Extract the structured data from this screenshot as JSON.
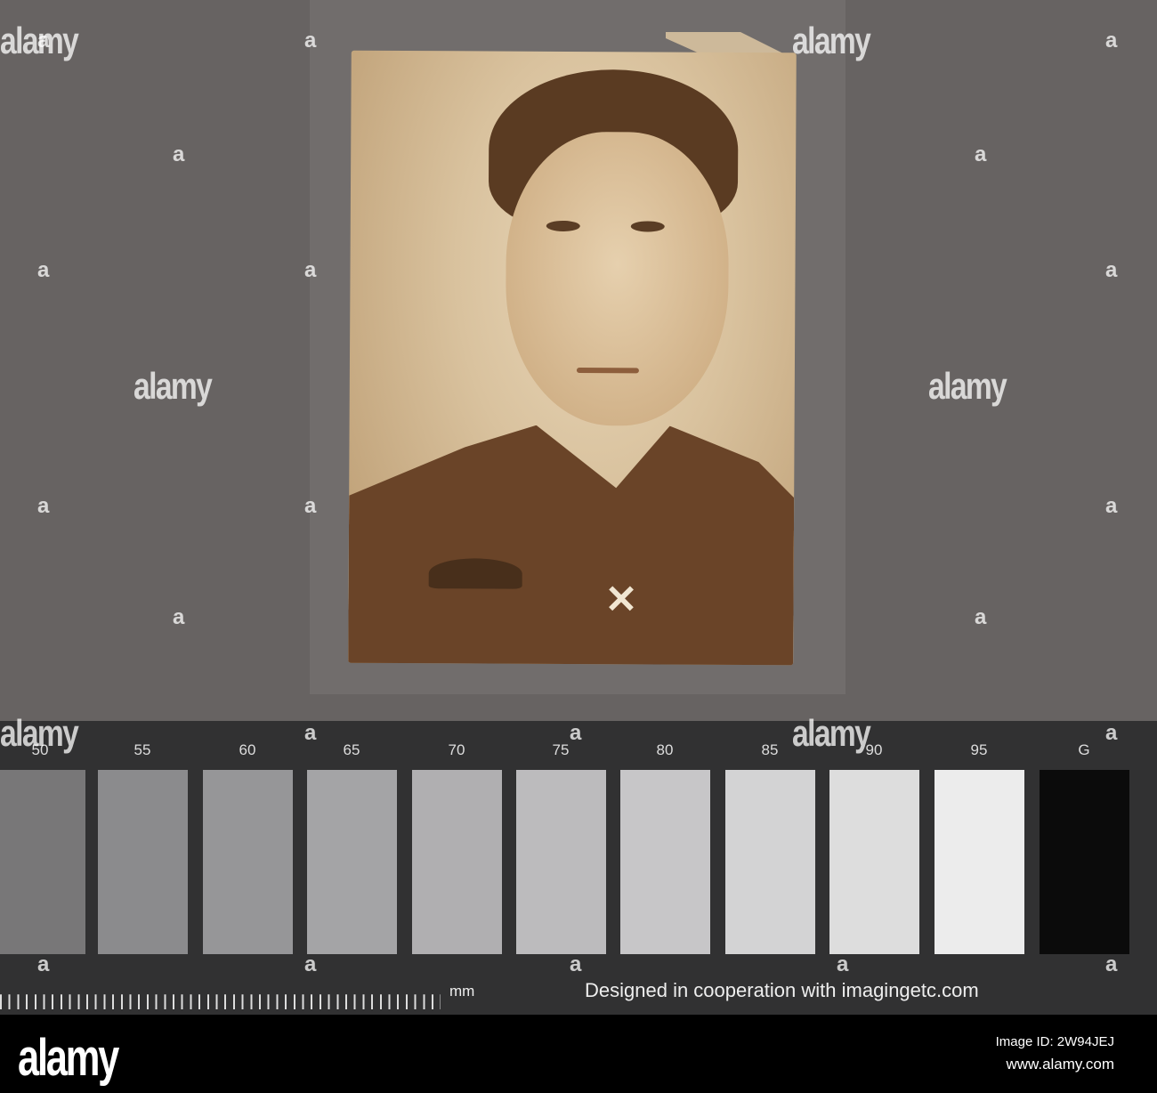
{
  "watermark": {
    "logo": "alamy",
    "mark": "a"
  },
  "scale": {
    "labels": [
      "50",
      "55",
      "60",
      "65",
      "70",
      "75",
      "80",
      "85",
      "90",
      "95",
      "G"
    ],
    "colors": [
      "#787778",
      "#8b8b8d",
      "#969698",
      "#a4a4a6",
      "#b0afb1",
      "#bcbbbd",
      "#c7c6c8",
      "#d3d3d4",
      "#dddddd",
      "#ececec",
      "#0b0b0b"
    ],
    "unit": "mm",
    "credit": "Designed in cooperation with imagingetc.com"
  },
  "footer": {
    "logo": "alamy",
    "image_id": "Image ID: 2W94JEJ",
    "url": "www.alamy.com"
  }
}
